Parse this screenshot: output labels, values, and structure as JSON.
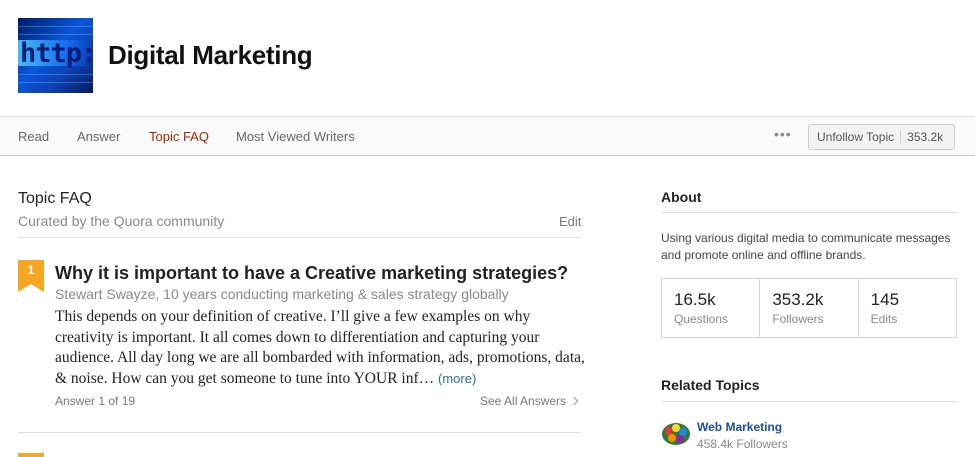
{
  "topic": {
    "title": "Digital Marketing",
    "image_icon": "http-address-bar-image",
    "image_text": "http:/"
  },
  "nav": {
    "tabs": [
      {
        "label": "Read",
        "active": false
      },
      {
        "label": "Answer",
        "active": false
      },
      {
        "label": "Topic FAQ",
        "active": true
      },
      {
        "label": "Most Viewed Writers",
        "active": false
      }
    ],
    "more_label": "•••",
    "unfollow_label": "Unfollow Topic",
    "follower_count": "353.2k",
    "active_color": "#a82400"
  },
  "faq": {
    "title": "Topic FAQ",
    "subtitle": "Curated by the Quora community",
    "edit_label": "Edit",
    "items": [
      {
        "rank": "1",
        "question": "Why it is important to have a Creative marketing strategies?",
        "author": "Stewart Swayze, 10 years conducting marketing & sales strategy globally",
        "body": "This depends on your definition of creative. I’ll give a few examples on why creativity is important. It all comes down to differentiation and capturing your audience. All day long we are all bombarded with information, ads, promotions, data, & noise. How can you get someone to tune into YOUR inf…",
        "more_label": "(more)",
        "answer_count": "Answer 1 of 19",
        "see_all_label": "See All Answers"
      }
    ],
    "badge_color": "#f5a623"
  },
  "about": {
    "title": "About",
    "description": "Using various digital media to communicate messages and promote online and offline brands.",
    "stats": [
      {
        "value": "16.5k",
        "label": "Questions"
      },
      {
        "value": "353.2k",
        "label": "Followers"
      },
      {
        "value": "145",
        "label": "Edits"
      }
    ]
  },
  "related": {
    "title": "Related Topics",
    "items": [
      {
        "name": "Web Marketing",
        "followers": "458.4k Followers",
        "icon": "web-marketing-colorful-icon"
      }
    ]
  }
}
